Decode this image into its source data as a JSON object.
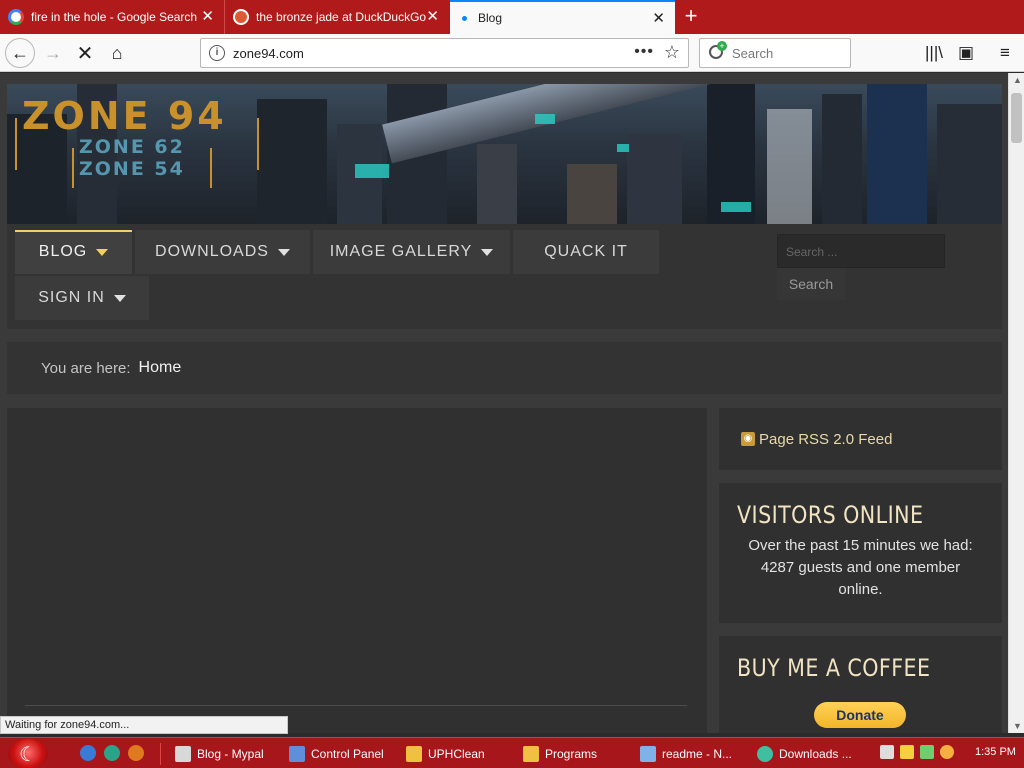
{
  "browser": {
    "tabs": [
      {
        "title": "fire in the hole - Google Search"
      },
      {
        "title": "the bronze jade at DuckDuckGo"
      },
      {
        "title": "Blog"
      }
    ],
    "url": "zone94.com",
    "search_placeholder": "Search",
    "status_text": "Waiting for zone94.com..."
  },
  "site": {
    "logo_main": "ZONE 94",
    "logo_sub_1": "ZONE 62",
    "logo_sub_2": "ZONE 54",
    "menu": [
      {
        "label": "BLOG",
        "has_caret": true
      },
      {
        "label": "DOWNLOADS",
        "has_caret": true
      },
      {
        "label": "IMAGE GALLERY",
        "has_caret": true
      },
      {
        "label": "QUACK IT",
        "has_caret": false
      },
      {
        "label": "SIGN IN",
        "has_caret": true
      }
    ],
    "search_placeholder": "Search ...",
    "search_button": "Search",
    "breadcrumb_label": "You are here:",
    "breadcrumb_current": "Home",
    "rss_text": "Page RSS 2.0 Feed",
    "visitors_title": "VISITORS ONLINE",
    "visitors_text": "Over the past 15 minutes we had: 4287 guests and one member online.",
    "coffee_title": "BUY ME A COFFEE",
    "donate_label": "Donate"
  },
  "taskbar": {
    "items": [
      {
        "label": "Blog - Mypal"
      },
      {
        "label": "Control Panel"
      },
      {
        "label": "UPHClean"
      },
      {
        "label": "Programs"
      },
      {
        "label": "readme - N..."
      },
      {
        "label": "Downloads ..."
      }
    ],
    "clock": "1:35 PM"
  },
  "colors": {
    "tabbar": "#b01a1a",
    "taskbar": "#a7161a",
    "accent_gold": "#f0d060",
    "logo_orange": "#c8912c",
    "donate_yellow": "#ffc439"
  }
}
